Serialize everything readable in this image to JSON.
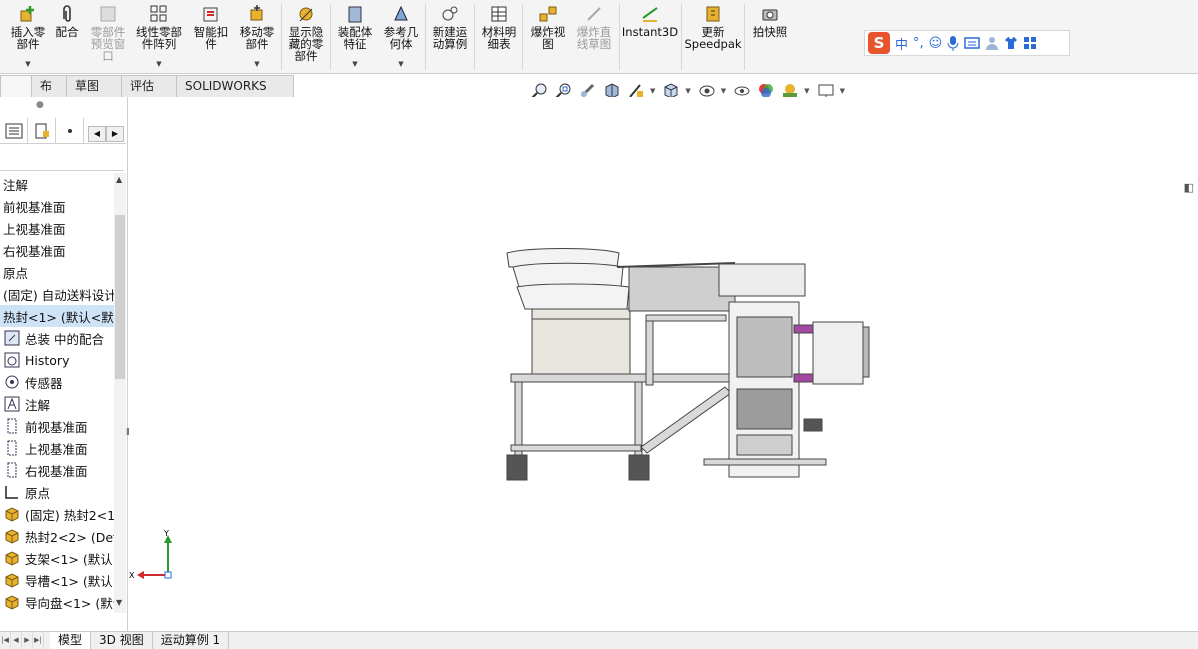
{
  "ribbon": {
    "insert_components": "插入零\n部件",
    "mate": "配合",
    "component_preview": "零部件\n预览窗\n口",
    "linear_pattern": "线性零部\n件阵列",
    "smart_fasteners": "智能扣\n件",
    "move_component": "移动零\n部件",
    "show_hidden": "显示隐\n藏的零\n部件",
    "assembly_features": "装配体\n特征",
    "reference_geometry": "参考几\n何体",
    "new_motion_study": "新建运\n动算例",
    "bom": "材料明\n细表",
    "exploded_view": "爆炸视\n图",
    "explode_line_sketch": "爆炸直\n线草图",
    "instant3d": "Instant3D",
    "update_speedpak": "更新\nSpeedpak",
    "snapshot": "拍快照"
  },
  "ime": {
    "logo": "S",
    "mode": "中",
    "punct": "°,"
  },
  "command_tabs": [
    "布局",
    "草图",
    "评估",
    "SOLIDWORKS MBD"
  ],
  "tree": {
    "items": [
      {
        "label": "注解",
        "icon": "none"
      },
      {
        "label": "前视基准面",
        "icon": "none"
      },
      {
        "label": "上视基准面",
        "icon": "none"
      },
      {
        "label": "右视基准面",
        "icon": "none"
      },
      {
        "label": "原点",
        "icon": "none"
      },
      {
        "label": "(固定) 自动送料设计",
        "icon": "none"
      },
      {
        "label": "热封<1> (默认<默认",
        "icon": "none",
        "selected": true
      },
      {
        "label": "总装 中的配合",
        "icon": "mates-icon"
      },
      {
        "label": "History",
        "icon": "history-icon"
      },
      {
        "label": "传感器",
        "icon": "sensor-icon"
      },
      {
        "label": "注解",
        "icon": "annotation-icon"
      },
      {
        "label": "前视基准面",
        "icon": "plane-icon"
      },
      {
        "label": "上视基准面",
        "icon": "plane-icon"
      },
      {
        "label": "右视基准面",
        "icon": "plane-icon"
      },
      {
        "label": "原点",
        "icon": "origin-icon"
      },
      {
        "label": "(固定) 热封2<1",
        "icon": "part-icon"
      },
      {
        "label": "热封2<2> (Def",
        "icon": "part-icon"
      },
      {
        "label": "支架<1> (默认<",
        "icon": "part-icon"
      },
      {
        "label": "导槽<1> (默认<",
        "icon": "part-icon"
      },
      {
        "label": "导向盘<1> (默认",
        "icon": "part-icon"
      }
    ]
  },
  "triad": {
    "y": "Y",
    "x": "X"
  },
  "bottom_tabs": [
    "模型",
    "3D 视图",
    "运动算例 1"
  ],
  "colors": {
    "accent": "#2a6bd8",
    "selection": "#cfe3f7",
    "ime_logo": "#e8542d"
  }
}
